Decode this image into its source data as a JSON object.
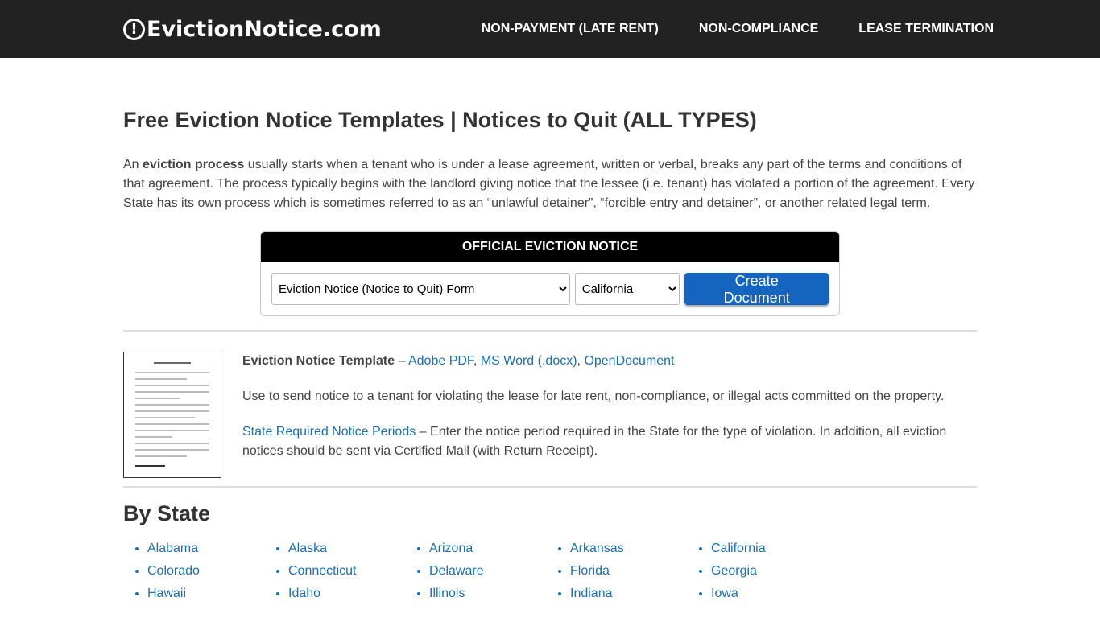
{
  "header": {
    "logo": "EvictionNotice.com",
    "nav": [
      "NON-PAYMENT (LATE RENT)",
      "NON-COMPLIANCE",
      "LEASE TERMINATION"
    ]
  },
  "title": "Free Eviction Notice Templates | Notices to Quit (ALL TYPES)",
  "intro": {
    "pre": "An ",
    "bold": "eviction process",
    "post": " usually starts when a tenant who is under a lease agreement, written or verbal, breaks any part of the terms and conditions of that agreement. The process typically begins with the landlord giving notice that the lessee (i.e. tenant) has violated a portion of the agreement. Every State has its own process which is sometimes referred to as an “unlawful detainer”, “forcible entry and detainer”, or another related legal term."
  },
  "form": {
    "title": "OFFICIAL EVICTION NOTICE",
    "doc_type": "Eviction Notice (Notice to Quit) Form",
    "state": "California",
    "button": "Create Document"
  },
  "template": {
    "name": "Eviction Notice Template",
    "sep": " – ",
    "links": [
      "Adobe PDF",
      "MS Word (.docx)",
      "OpenDocument"
    ],
    "desc": "Use to send notice to a tenant for violating the lease for late rent, non-compliance, or illegal acts committed on the property.",
    "periods_link": "State Required Notice Periods",
    "periods_text": " – Enter the notice period required in the State for the type of violation. In addition, all eviction notices should be sent via Certified Mail (with Return Receipt)."
  },
  "by_state": {
    "title": "By State",
    "states": [
      "Alabama",
      "Alaska",
      "Arizona",
      "Arkansas",
      "California",
      "Colorado",
      "Connecticut",
      "Delaware",
      "Florida",
      "Georgia",
      "Hawaii",
      "Idaho",
      "Illinois",
      "Indiana",
      "Iowa"
    ]
  }
}
